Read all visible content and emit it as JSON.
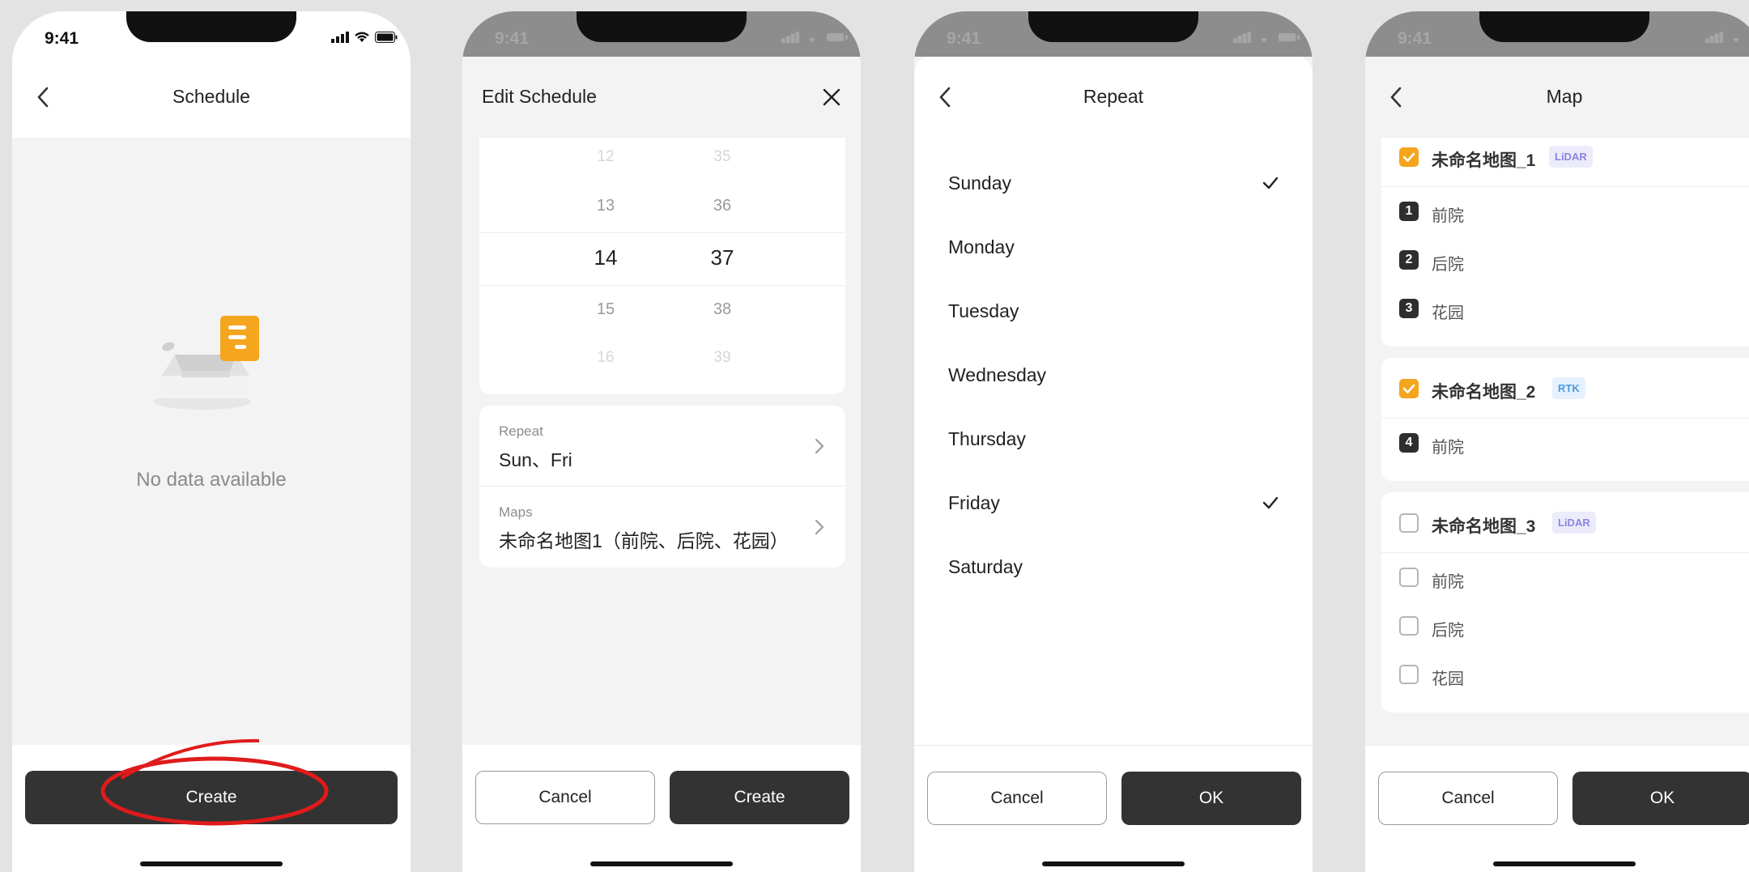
{
  "status": {
    "time": "9:41"
  },
  "screen_schedule": {
    "title": "Schedule",
    "empty_text": "No data available",
    "create_button": "Create"
  },
  "screen_edit": {
    "title": "Edit Schedule",
    "picker": {
      "hours": [
        "12",
        "13",
        "14",
        "15",
        "16"
      ],
      "minutes": [
        "35",
        "36",
        "37",
        "38",
        "39"
      ],
      "selected_hour": "14",
      "selected_minute": "37"
    },
    "repeat_label": "Repeat",
    "repeat_value": "Sun、Fri",
    "maps_label": "Maps",
    "maps_value": "未命名地图1（前院、后院、花园）",
    "cancel_button": "Cancel",
    "create_button": "Create"
  },
  "screen_repeat": {
    "title": "Repeat",
    "days": [
      {
        "label": "Sunday",
        "checked": true
      },
      {
        "label": "Monday",
        "checked": false
      },
      {
        "label": "Tuesday",
        "checked": false
      },
      {
        "label": "Wednesday",
        "checked": false
      },
      {
        "label": "Thursday",
        "checked": false
      },
      {
        "label": "Friday",
        "checked": true
      },
      {
        "label": "Saturday",
        "checked": false
      }
    ],
    "cancel_button": "Cancel",
    "ok_button": "OK"
  },
  "screen_map": {
    "title": "Map",
    "maps": [
      {
        "name": "未命名地图_1",
        "tag": "LiDAR",
        "checked": true,
        "zones": [
          {
            "num": "1",
            "name": "前院"
          },
          {
            "num": "2",
            "name": "后院"
          },
          {
            "num": "3",
            "name": "花园"
          }
        ]
      },
      {
        "name": "未命名地图_2",
        "tag": "RTK",
        "checked": true,
        "zones": [
          {
            "num": "4",
            "name": "前院"
          }
        ]
      },
      {
        "name": "未命名地图_3",
        "tag": "LiDAR",
        "checked": false,
        "zones": [
          {
            "name": "前院",
            "checked": false
          },
          {
            "name": "后院",
            "checked": false
          },
          {
            "name": "花园",
            "checked": false
          }
        ]
      }
    ],
    "cancel_button": "Cancel",
    "ok_button": "OK"
  },
  "colors": {
    "accent": "#f5a51e",
    "primary_button": "#333333",
    "annotation_ring": "#e01b1b",
    "lidar_tag": "#8b85df",
    "rtk_tag": "#4a9be0"
  }
}
